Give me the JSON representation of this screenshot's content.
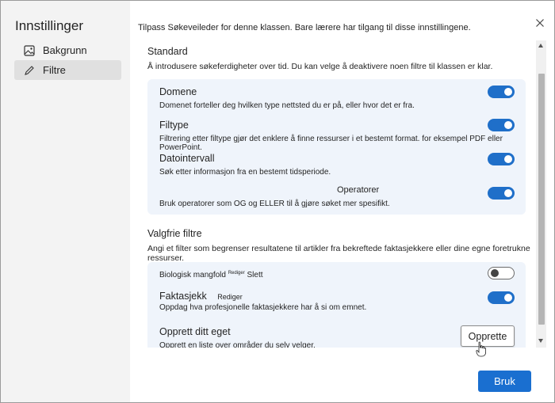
{
  "sidebar": {
    "title": "Innstillinger",
    "items": [
      {
        "label": "Bakgrunn",
        "icon": "image-icon"
      },
      {
        "label": "Filtre",
        "icon": "pencil-icon"
      }
    ]
  },
  "header": {
    "description": "Tilpass Søkeveileder for denne klassen. Bare lærere har tilgang til disse innstillingene."
  },
  "standard": {
    "title": "Standard",
    "description": "Å introdusere søkeferdigheter over tid. Du kan velge å deaktivere noen filtre til klassen er klar.",
    "filters": [
      {
        "title": "Domene",
        "description": "Domenet forteller deg hvilken type nettsted du er på, eller hvor det er fra.",
        "enabled": true
      },
      {
        "title": "Filtype",
        "description": "Filtrering etter filtype gjør det enklere å finne ressurser i et bestemt format. for eksempel PDF eller PowerPoint.",
        "enabled": true
      },
      {
        "title": "Datointervall",
        "description": "Søk etter informasjon fra en bestemt tidsperiode.",
        "enabled": true
      },
      {
        "title": "Operatorer",
        "description": "Bruk operatorer som OG og ELLER til å gjøre søket mer spesifikt.",
        "enabled": true
      }
    ]
  },
  "optional": {
    "title": "Valgfrie filtre",
    "description": "Angi et filter som begrenser resultatene til artikler fra bekreftede faktasjekkere eller dine egne foretrukne ressurser.",
    "filters": [
      {
        "title": "Biologisk mangfold",
        "edit_label": "Rediger",
        "delete_label": "Slett",
        "enabled": false
      },
      {
        "title": "Faktasjekk",
        "edit_label": "Rediger",
        "description": "Oppdag hva profesjonelle faktasjekkere har å si om emnet.",
        "enabled": true
      },
      {
        "title": "Opprett ditt eget",
        "description": "Opprett en liste over områder du selv velger.",
        "button_label": "Opprette"
      }
    ]
  },
  "footer": {
    "apply_label": "Bruk"
  },
  "colors": {
    "accent": "#1a6fd0",
    "card_bg": "#eff4fb",
    "sidebar_bg": "#f3f3f3"
  }
}
